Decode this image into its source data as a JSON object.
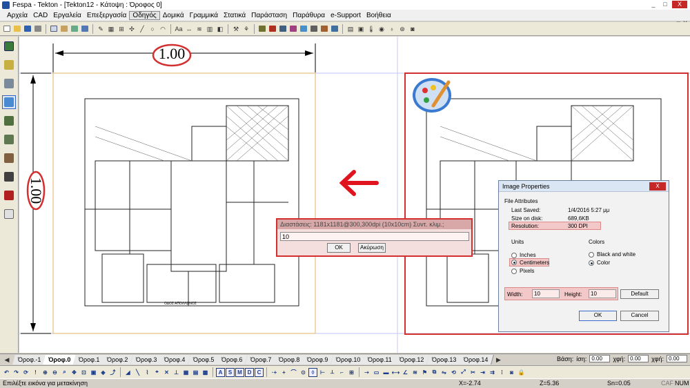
{
  "window": {
    "title": "Fespa - Tekton - [Tekton12 - Κάτοψη : Όροφος 0]",
    "min": "_",
    "max": "□",
    "close": "X"
  },
  "menu": [
    "Αρχεία",
    "CAD",
    "Εργαλεία",
    "Επεξεργασία",
    "Οδηγός",
    "Δομικά",
    "Γραμμικά",
    "Στατικά",
    "Παράσταση",
    "Παράθυρα",
    "e-Support",
    "Βοήθεια"
  ],
  "menu_active_index": 4,
  "canvas": {
    "dim_horizontal": "1.00",
    "dim_vertical": "1.00",
    "plan_title": "ΟΔΟΣ ΑΠΟΛΛΩΝΟΣ"
  },
  "dimension_dialog": {
    "header": "Διαστάσεις: 1181x1181@300,300dpi (10x10cm) Συντ. κλιμ.;",
    "value": "10",
    "ok": "OK",
    "cancel": "Ακύρωση"
  },
  "image_props": {
    "title": "Image Properties",
    "file_attributes": "File Attributes",
    "last_saved_label": "Last Saved:",
    "last_saved_value": "1/4/2016 5:27 μμ",
    "size_label": "Size on disk:",
    "size_value": "689,6KB",
    "resolution_label": "Resolution:",
    "resolution_value": "300 DPI",
    "units_label": "Units",
    "colors_label": "Colors",
    "units": [
      "Inches",
      "Centimeters",
      "Pixels"
    ],
    "units_selected": 1,
    "colors": [
      "Black and white",
      "Color"
    ],
    "colors_selected": 1,
    "width_label": "Width:",
    "width_value": "10",
    "height_label": "Height:",
    "height_value": "10",
    "default_btn": "Default",
    "ok_btn": "OK",
    "cancel_btn": "Cancel"
  },
  "tabs": [
    "Όροφ.-1",
    "Όροφ.0",
    "Όροφ.1",
    "Όροφ.2",
    "Όροφ.3",
    "Όροφ.4",
    "Όροφ.5",
    "Όροφ.6",
    "Όροφ.7",
    "Όροφ.8",
    "Όροφ.9",
    "Όροφ.10",
    "Όροφ.11",
    "Όροφ.12",
    "Όροφ.13",
    "Όροφ.14"
  ],
  "tab_active_index": 1,
  "base": {
    "label": "Βάση:",
    "isi_label": "ίση:",
    "isi_value": "0.00",
    "xfi_label": "χφή:",
    "xfi_value": "0.00",
    "xfi2_label": "χφή:",
    "xfi2_value": "0.00"
  },
  "bottom_letters": [
    "A",
    "S",
    "M",
    "D",
    "C"
  ],
  "status": {
    "message": "Επιλέξτε εικόνα για μετακίνηση",
    "x": "X=-2.74",
    "z": "Z=5.36",
    "sn": "Sn=0.05",
    "caf": "CAF",
    "num": "NUM"
  },
  "colors": {
    "highlight_red": "#d32f2f",
    "dialog_pink": "#f4dede",
    "arrow_red": "#e0141e"
  }
}
